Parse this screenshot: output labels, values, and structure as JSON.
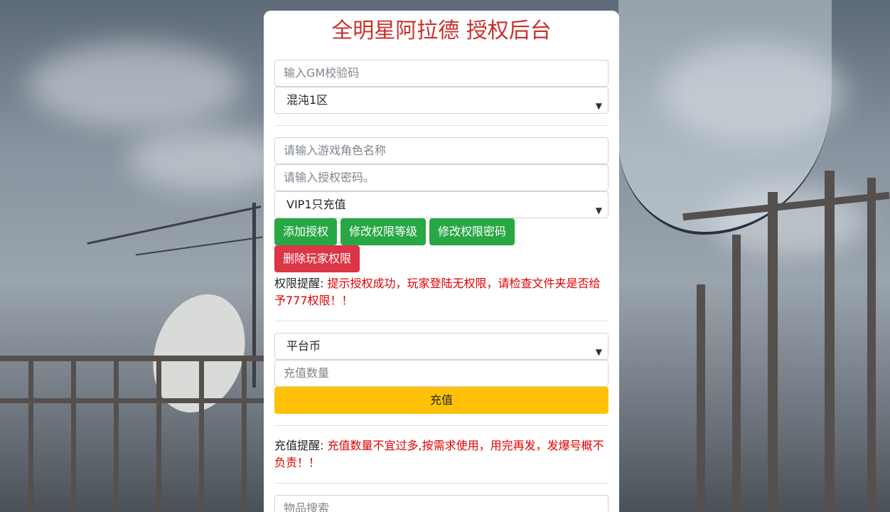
{
  "title": "全明星阿拉德 授权后台",
  "gm_code": {
    "placeholder": "输入GM校验码"
  },
  "region_select": {
    "selected": "混沌1区"
  },
  "role_name": {
    "placeholder": "请输入游戏角色名称"
  },
  "auth_password": {
    "placeholder": "请输入授权密码。"
  },
  "vip_select": {
    "selected": "VIP1只充值"
  },
  "buttons": {
    "add_auth": "添加授权",
    "modify_level": "修改权限等级",
    "modify_password": "修改权限密码",
    "delete_auth": "删除玩家权限",
    "recharge": "充值"
  },
  "auth_notice": {
    "label": "权限提醒:",
    "message": "提示授权成功，玩家登陆无权限，请检查文件夹是否给予777权限！！"
  },
  "currency_select": {
    "selected": "平台币"
  },
  "recharge_amount": {
    "placeholder": "充值数量"
  },
  "recharge_notice": {
    "label": "充值提醒:",
    "message": "充值数量不宜过多,按需求使用，用完再发，发爆号概不负责！！"
  },
  "item_search": {
    "placeholder": "物品搜索"
  },
  "colors": {
    "title": "#c9302c",
    "green": "#28a745",
    "red": "#dc3545",
    "yellow": "#ffc107",
    "notice": "#e00000"
  }
}
